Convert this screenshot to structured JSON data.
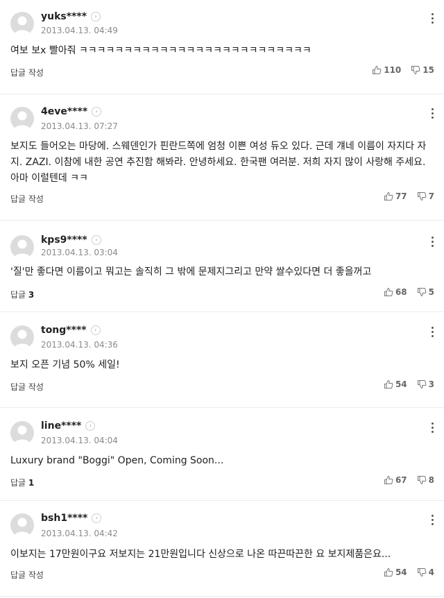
{
  "reply_label": "답글 작성",
  "reply_prefix": "답글",
  "comments": [
    {
      "user": "yuks****",
      "date": "2013.04.13. 04:49",
      "text": "여보 보x 빨아줘 ㅋㅋㅋㅋㅋㅋㅋㅋㅋㅋㅋㅋㅋㅋㅋㅋㅋㅋㅋㅋㅋㅋㅋㅋㅋㅋ",
      "replies": "",
      "likes": "110",
      "dislikes": "15"
    },
    {
      "user": "4eve****",
      "date": "2013.04.13. 07:27",
      "text": "보지도 들어오는 마당에. 스웨덴인가 핀란드쪽에 엄청 이쁜 여성 듀오 있다. 근데 걔네 이름이 자지다 자지. ZAZI. 이참에 내한 공연 추진함 해봐라. 안녕하세요. 한국팬 여러분. 저희 자지 많이 사랑해 주세요. 아마 이럴텐데 ㅋㅋ",
      "replies": "",
      "likes": "77",
      "dislikes": "7"
    },
    {
      "user": "kps9****",
      "date": "2013.04.13. 03:04",
      "text": "'질'만 좋다면 이름이고 뭐고는 솔직히 그 밖에 문제지그리고 만약 쌀수있다면 더 좋을꺼고",
      "replies": "3",
      "likes": "68",
      "dislikes": "5"
    },
    {
      "user": "tong****",
      "date": "2013.04.13. 04:36",
      "text": "보지 오픈 기념 50% 세일!",
      "replies": "",
      "likes": "54",
      "dislikes": "3"
    },
    {
      "user": "line****",
      "date": "2013.04.13. 04:04",
      "text": "Luxury brand \"Boggi\" Open, Coming Soon...",
      "replies": "1",
      "likes": "67",
      "dislikes": "8"
    },
    {
      "user": "bsh1****",
      "date": "2013.04.13. 04:42",
      "text": "이보지는 17만원이구요 저보지는 21만원입니다 신상으로 나온 따끈따끈한 요 보지제품은요...",
      "replies": "",
      "likes": "54",
      "dislikes": "4"
    }
  ]
}
